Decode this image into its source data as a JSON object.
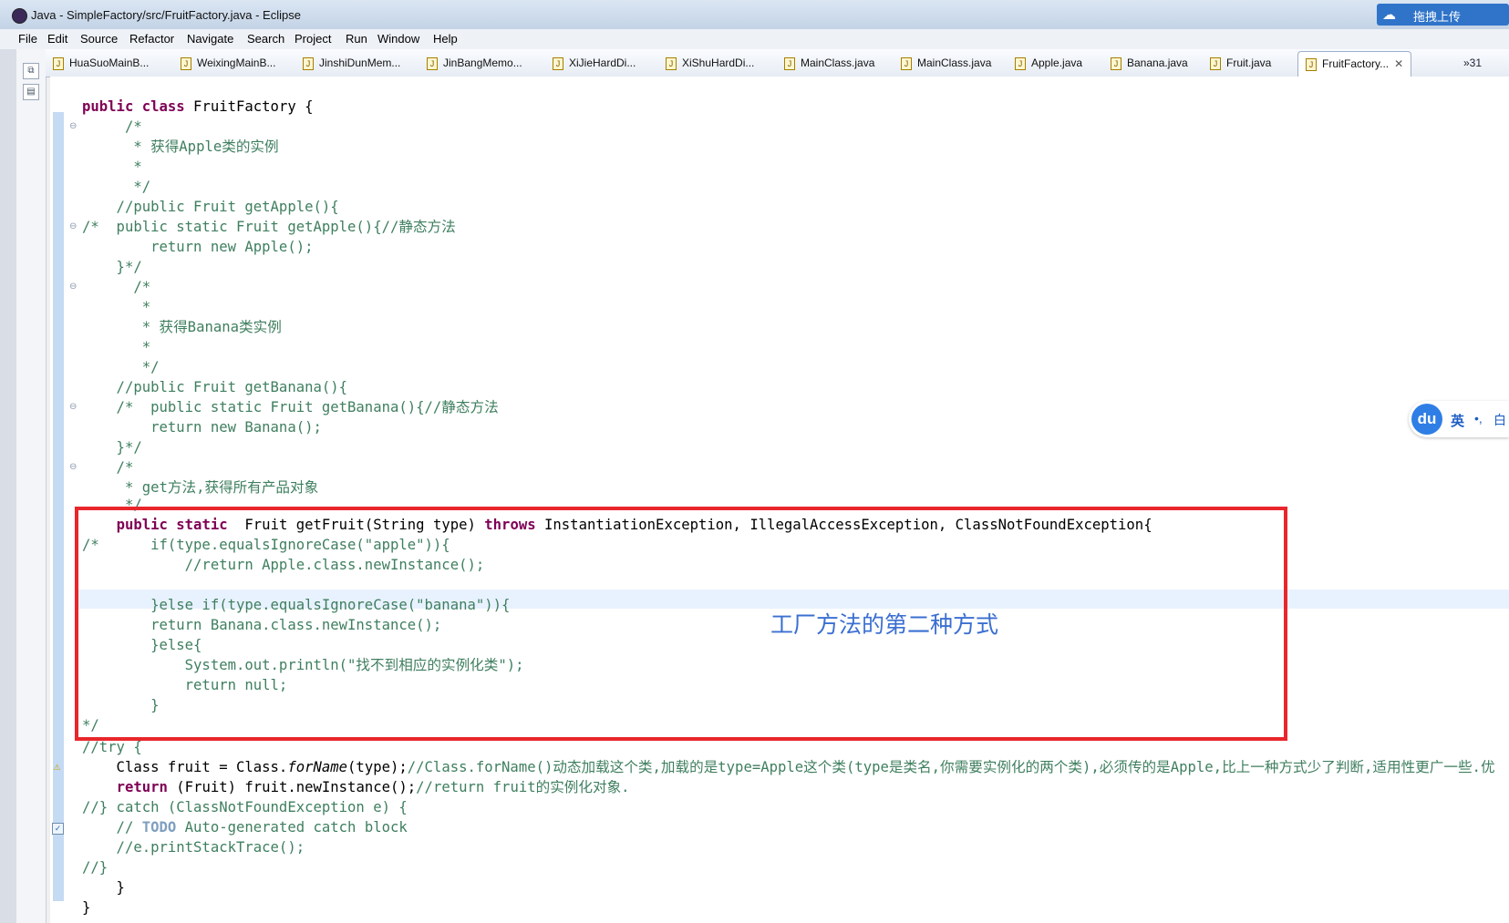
{
  "window": {
    "title": "Java - SimpleFactory/src/FruitFactory.java - Eclipse"
  },
  "upload_button": {
    "label": "拖拽上传"
  },
  "menu": [
    "File",
    "Edit",
    "Source",
    "Refactor",
    "Navigate",
    "Search",
    "Project",
    "Run",
    "Window",
    "Help"
  ],
  "tabs": [
    "HuaSuoMainB...",
    "WeixingMainB...",
    "JinshiDunMem...",
    "JinBangMemo...",
    "XiJieHardDi...",
    "XiShuHardDi...",
    "MainClass.java",
    "MainClass.java",
    "Apple.java",
    "Banana.java",
    "Fruit.java",
    "FruitFactory..."
  ],
  "tab_overflow": "»31",
  "annotation": "工厂方法的第二种方式",
  "ime": {
    "logo": "du",
    "mode": "英",
    "punct": "•,",
    "more": "白"
  },
  "code": {
    "l1": "public class FruitFactory {",
    "l2": "     /*",
    "l3": "      * 获得Apple类的实例",
    "l4": "      *",
    "l5": "      */",
    "l6": "    //public Fruit getApple(){",
    "l7": "/*  public static Fruit getApple(){//静态方法",
    "l8": "        return new Apple();",
    "l9": "    }*/",
    "l10": "      /*",
    "l11": "       *",
    "l12": "       * 获得Banana类实例",
    "l13": "       *",
    "l14": "       */",
    "l15": "    //public Fruit getBanana(){",
    "l16": "    /*  public static Fruit getBanana(){//静态方法",
    "l17": "        return new Banana();",
    "l18": "    }*/",
    "l19": "    /*",
    "l20": "     * get方法,获得所有产品对象",
    "l21": "     */",
    "l22_kw": "public static",
    "l22_mid": "  Fruit getFruit(String type) ",
    "l22_throws": "throws",
    "l22_rest": " InstantiationException, IllegalAccessException, ClassNotFoundException{",
    "l23": "/*      if(type.equalsIgnoreCase(\"apple\")){",
    "l24": "            //return Apple.class.newInstance();",
    "l25": "",
    "l26": "        }else if(type.equalsIgnoreCase(\"banana\")){",
    "l27": "        return Banana.class.newInstance();",
    "l28": "        }else{",
    "l29": "            System.out.println(\"找不到相应的实例化类\");",
    "l30": "            return null;",
    "l31": "        }",
    "l32": "*/",
    "l33": "//try {",
    "l34_a": "    Class fruit = Class.",
    "l34_b": "forName",
    "l34_c": "(type);",
    "l34_cm": "//Class.forName()动态加载这个类,加载的是type=Apple这个类(type是类名,你需要实例化的两个类),必须传的是Apple,比上一种方式少了判断,适用性更广一些.优",
    "l35_kw": "return",
    "l35_a": " (Fruit) fruit.newInstance();",
    "l35_cm": "//return fruit的实例化对象.",
    "l36": "//} catch (ClassNotFoundException e) {",
    "l37_a": "    // ",
    "l37_todo": "TODO",
    "l37_b": " Auto-generated catch block",
    "l38": "    //e.printStackTrace();",
    "l39": "//}",
    "l40": "    }",
    "l41": "}"
  }
}
